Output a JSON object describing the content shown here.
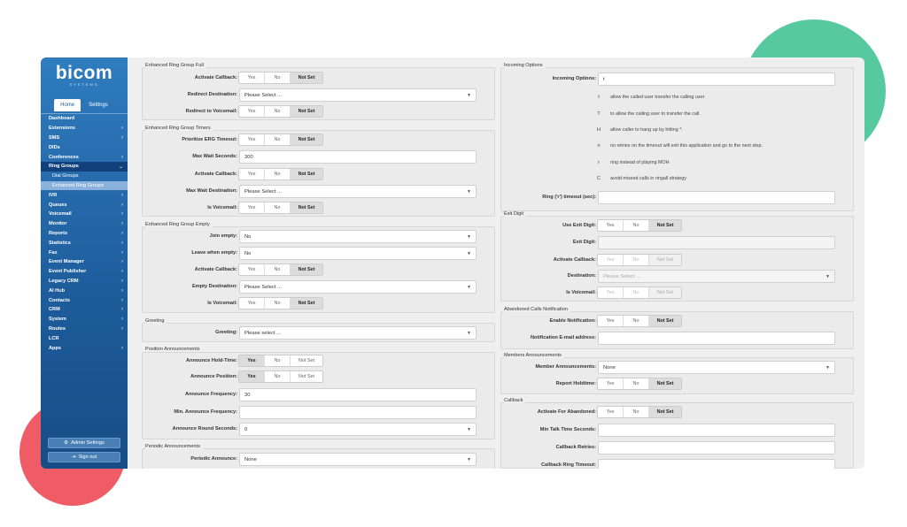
{
  "sidebar": {
    "logo": "bicom",
    "logo_sub": "SYSTEMS",
    "tabs": [
      "Home",
      "Settings"
    ],
    "items": [
      {
        "label": "Dashboard",
        "chevron": ""
      },
      {
        "label": "Extensions",
        "chevron": "›"
      },
      {
        "label": "SMS",
        "chevron": "›"
      },
      {
        "label": "DIDs",
        "chevron": ""
      },
      {
        "label": "Conferences",
        "chevron": "›"
      },
      {
        "label": "Ring Groups",
        "chevron": "⌄"
      },
      {
        "label": "Dial Groups",
        "chevron": ""
      },
      {
        "label": "Enhanced Ring Groups",
        "chevron": ""
      },
      {
        "label": "IVR",
        "chevron": "›"
      },
      {
        "label": "Queues",
        "chevron": "›"
      },
      {
        "label": "Voicemail",
        "chevron": "›"
      },
      {
        "label": "Monitor",
        "chevron": "›"
      },
      {
        "label": "Reports",
        "chevron": "›"
      },
      {
        "label": "Statistics",
        "chevron": "›"
      },
      {
        "label": "Fax",
        "chevron": "›"
      },
      {
        "label": "Event Manager",
        "chevron": "›"
      },
      {
        "label": "Event Publisher",
        "chevron": "›"
      },
      {
        "label": "Legacy CRM",
        "chevron": "›"
      },
      {
        "label": "AI Hub",
        "chevron": "›"
      },
      {
        "label": "Contacts",
        "chevron": "›"
      },
      {
        "label": "CRM",
        "chevron": "›"
      },
      {
        "label": "System",
        "chevron": "›"
      },
      {
        "label": "Routes",
        "chevron": "›"
      },
      {
        "label": "LCR",
        "chevron": ""
      },
      {
        "label": "Apps",
        "chevron": "›"
      }
    ],
    "admin_settings": "Admin Settings",
    "sign_out": "Sign out"
  },
  "seg_labels": {
    "yes": "Yes",
    "no": "No",
    "notset": "Not Set"
  },
  "left": {
    "full": {
      "title": "Enhanced Ring Group Full",
      "activate_callback": "Activate Callback:",
      "redirect_destination": "Redirect Destination:",
      "redirect_destination_value": "Please Select ...",
      "redirect_to_voicemail": "Redirect to Voicemail:"
    },
    "timers": {
      "title": "Enhanced Ring Group Timers",
      "prioritize": "Prioritize ERG Timeout:",
      "max_wait": "Max Wait Seconds:",
      "max_wait_value": "300",
      "activate_callback": "Activate Callback:",
      "max_wait_dest": "Max Wait Destination:",
      "max_wait_dest_value": "Please Select ...",
      "is_voicemail": "Is Voicemail:"
    },
    "empty": {
      "title": "Enhanced Ring Group Empty",
      "join_empty": "Join empty:",
      "join_empty_value": "No",
      "leave_empty": "Leave when empty:",
      "leave_empty_value": "No",
      "activate_callback": "Activate Callback:",
      "empty_dest": "Empty Destination:",
      "empty_dest_value": "Please Select ...",
      "is_voicemail": "Is Voicemail:"
    },
    "greeting": {
      "title": "Greeting",
      "greeting": "Greeting:",
      "greeting_value": "Please select ..."
    },
    "position": {
      "title": "Position Announcements",
      "hold_time": "Announce Hold-Time:",
      "announce_position": "Announce Position:",
      "frequency": "Announce Frequency:",
      "frequency_value": "30",
      "min_frequency": "Min. Announce Frequency:",
      "round_seconds": "Announce Round Seconds:",
      "round_seconds_value": "0"
    },
    "periodic": {
      "title": "Periodic Announcements",
      "periodic": "Periodic Announce:",
      "periodic_value": "None"
    }
  },
  "right": {
    "incoming": {
      "title": "Incoming Options",
      "incoming_options": "Incoming Options:",
      "incoming_options_value": "t",
      "options": [
        {
          "key": "t",
          "desc": "allow the called user transfer the calling user"
        },
        {
          "key": "T",
          "desc": "to allow the calling user to transfer the call."
        },
        {
          "key": "H",
          "desc": "allow caller to hang up by hitting *."
        },
        {
          "key": "n",
          "desc": "no retries on the timeout will exit this application and go to the next step."
        },
        {
          "key": "r",
          "desc": "ring instead of playing MOH"
        },
        {
          "key": "C",
          "desc": "avoid missed calls in ringall strategy"
        }
      ],
      "ring_timeout": "Ring ('r') timeout (sec):"
    },
    "exit": {
      "title": "Exit Digit",
      "use_exit_digit": "Use Exit Digit:",
      "exit_digit": "Exit Digit:",
      "activate_callback": "Activate Callback:",
      "destination": "Destination:",
      "destination_value": "Please Select ...",
      "is_voicemail": "Is Voicemail:"
    },
    "abandoned": {
      "title": "Abandoned Calls Notification",
      "enable": "Enable Notification:",
      "email": "Notification E-mail address:"
    },
    "members": {
      "title": "Members Announcements",
      "member_ann": "Member Announcements:",
      "member_ann_value": "None",
      "report_holdtime": "Report Holdtime:"
    },
    "callback": {
      "title": "Callback",
      "activate_abandoned": "Activate For Abandoned:",
      "min_talk": "Min Talk Time Seconds:",
      "retries": "Callback Retries:",
      "ring_timeout": "Callback Ring Timeout:"
    }
  }
}
